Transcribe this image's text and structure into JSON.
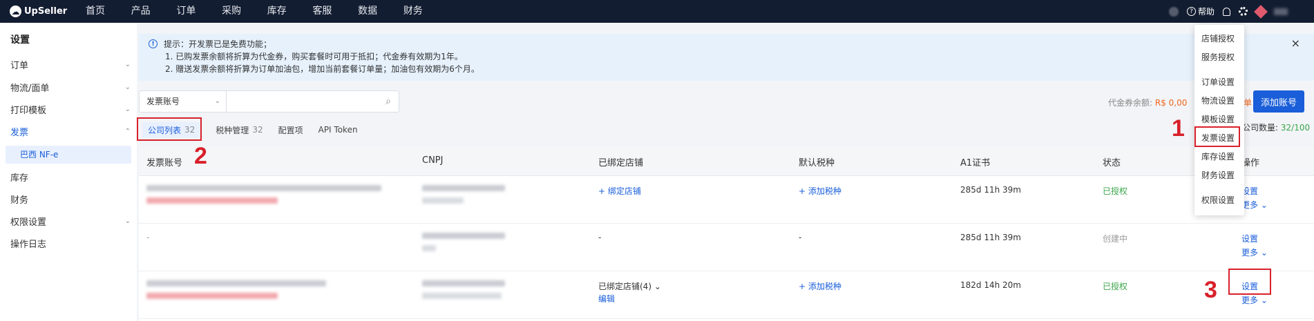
{
  "topnav": {
    "brand": "UpSeller",
    "items": [
      "首页",
      "产品",
      "订单",
      "采购",
      "库存",
      "客服",
      "数据",
      "财务"
    ],
    "help_label": "帮助"
  },
  "sidebar": {
    "title": "设置",
    "items": [
      {
        "label": "订单",
        "expandable": true
      },
      {
        "label": "物流/面单",
        "expandable": true
      },
      {
        "label": "打印模板",
        "expandable": true
      },
      {
        "label": "发票",
        "expandable": true,
        "active": true
      },
      {
        "label": "库存",
        "expandable": false
      },
      {
        "label": "财务",
        "expandable": false
      },
      {
        "label": "权限设置",
        "expandable": true
      },
      {
        "label": "操作日志",
        "expandable": false
      }
    ],
    "sub_item": "巴西 NF-e"
  },
  "notice": {
    "line1": "提示：开发票已是免费功能；",
    "line2": "1. 已购发票余额将折算为代金券，购买套餐时可用于抵扣；代金券有效期为1年。",
    "line3": "2. 赠送发票余额将折算为订单加油包，增加当前套餐订单量；加油包有效期为6个月。",
    "close": "×"
  },
  "toolbar": {
    "select_value": "发票账号",
    "search_placeholder": "",
    "voucher_label": "代金券余额:",
    "voucher_value": "R$ 0,00",
    "orange_tag": "单",
    "add_button": "添加账号",
    "count_label": "公司数量:",
    "count_value": "32/100"
  },
  "tabs": [
    {
      "label": "公司列表",
      "count": "32",
      "active": true
    },
    {
      "label": "税种管理",
      "count": "32",
      "active": false
    },
    {
      "label": "配置项",
      "count": "",
      "active": false
    },
    {
      "label": "API Token",
      "count": "",
      "active": false
    }
  ],
  "table": {
    "columns": [
      "发票账号",
      "CNPJ",
      "已绑定店铺",
      "默认税种",
      "A1证书",
      "状态",
      "操作"
    ],
    "rows": [
      {
        "account": "",
        "cnpj": "",
        "shops": "+ 绑定店铺",
        "shops_link": true,
        "shops_edit": "",
        "tax": "+ 添加税种",
        "tax_link": true,
        "cert": "285d 11h 39m",
        "status": "已授权",
        "status_type": "ok",
        "op1": "设置",
        "op2": "更多"
      },
      {
        "account": "-",
        "cnpj": "",
        "shops": "-",
        "shops_link": false,
        "shops_edit": "",
        "tax": "-",
        "tax_link": false,
        "cert": "285d 11h 39m",
        "status": "创建中",
        "status_type": "pending",
        "op1": "设置",
        "op2": "更多"
      },
      {
        "account": "",
        "cnpj": "",
        "shops": "已绑定店铺(4)",
        "shops_link": false,
        "shops_edit": "编辑",
        "tax": "+ 添加税种",
        "tax_link": true,
        "cert": "182d 14h 20m",
        "status": "已授权",
        "status_type": "ok",
        "op1": "设置",
        "op2": "更多"
      }
    ]
  },
  "settings_menu": {
    "items": [
      "店铺授权",
      "服务授权",
      "订单设置",
      "物流设置",
      "模板设置",
      "发票设置",
      "库存设置",
      "财务设置",
      "权限设置"
    ]
  },
  "annotations": [
    "1",
    "2",
    "3"
  ],
  "colors": {
    "nav_bg": "#131d31",
    "accent": "#1a5ed9",
    "authorized": "#3aa64a",
    "annotation": "#d8202a",
    "voucher": "#f0661f"
  }
}
